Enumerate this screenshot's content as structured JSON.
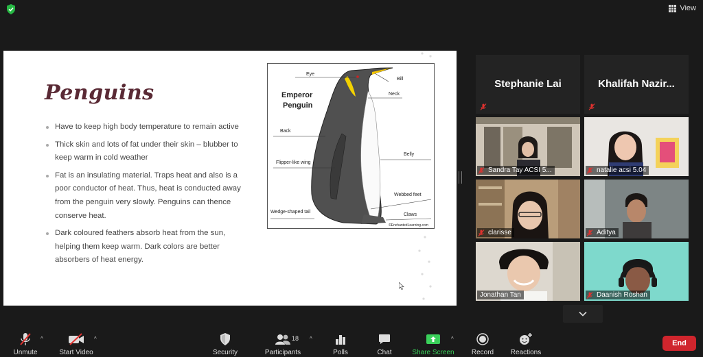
{
  "window": {
    "view_label": "View"
  },
  "slide": {
    "title": "Penguins",
    "bullets": [
      "Have to keep high body temperature to remain active",
      "Thick skin and lots of fat under their skin – blubber to keep warm in cold weather",
      "Fat is an insulating material. Traps heat and also is a poor conductor of heat. Thus, heat is conducted away from the penguin very slowly. Penguins can thence conserve heat.",
      "Dark coloured feathers absorb heat from the sun, helping them keep warm. Dark colors are better absorbers of heat energy."
    ],
    "diagram": {
      "heading_line1": "Emperor",
      "heading_line2": "Penguin",
      "labels": {
        "eye": "Eye",
        "bill": "Bill",
        "neck": "Neck",
        "back": "Back",
        "belly": "Belly",
        "flipper": "Flipper-like wing",
        "webbed": "Webbed feet",
        "claws": "Claws",
        "tail": "Wedge-shaped tail"
      },
      "credit": "©EnchantedLearning.com"
    }
  },
  "participants_gallery": [
    {
      "name": "Stephanie Lai",
      "muted": true,
      "video": false
    },
    {
      "name": "Khalifah  Nazir...",
      "muted": true,
      "video": false
    },
    {
      "name": "Sandra Tay ACSI 5...",
      "muted": true,
      "video": true
    },
    {
      "name": "natalie acsi 5.04",
      "muted": true,
      "video": true
    },
    {
      "name": "clarisse",
      "muted": true,
      "video": true
    },
    {
      "name": "Aditya",
      "muted": true,
      "video": true
    },
    {
      "name": "Jonathan Tan",
      "muted": false,
      "video": true,
      "active_speaker": true
    },
    {
      "name": "Daanish Roshan",
      "muted": true,
      "video": true
    }
  ],
  "toolbar": {
    "unmute": "Unmute",
    "start_video": "Start Video",
    "security": "Security",
    "participants": "Participants",
    "participants_count": "18",
    "polls": "Polls",
    "chat": "Chat",
    "share_screen": "Share Screen",
    "record": "Record",
    "reactions": "Reactions",
    "end": "End"
  },
  "colors": {
    "end_button": "#d0252d",
    "share_green": "#3ad05a",
    "active_speaker": "#e8d84a",
    "title": "#5a2a35"
  }
}
